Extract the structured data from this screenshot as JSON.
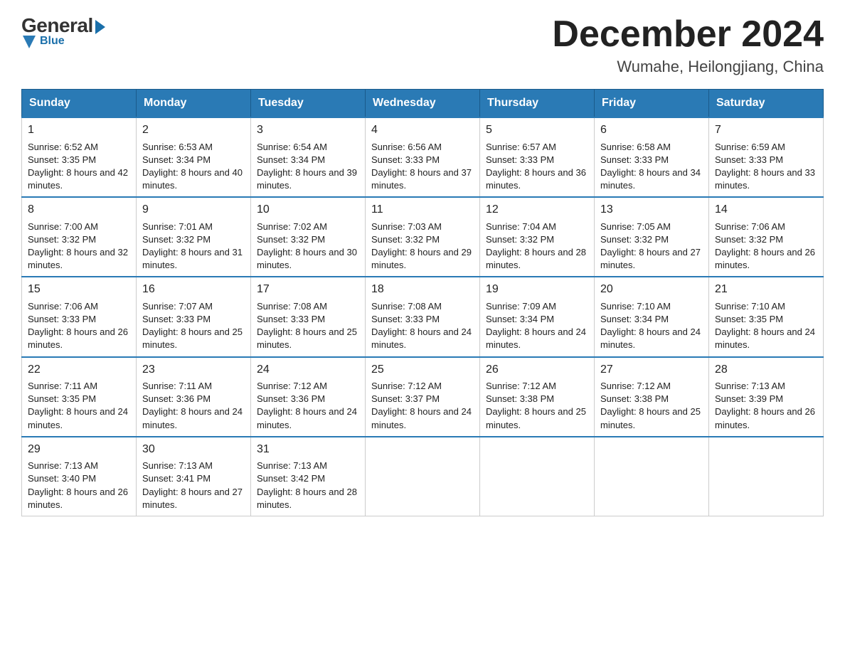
{
  "logo": {
    "general": "General",
    "blue": "Blue"
  },
  "header": {
    "month": "December 2024",
    "location": "Wumahe, Heilongjiang, China"
  },
  "days": [
    "Sunday",
    "Monday",
    "Tuesday",
    "Wednesday",
    "Thursday",
    "Friday",
    "Saturday"
  ],
  "weeks": [
    [
      {
        "day": "1",
        "sunrise": "6:52 AM",
        "sunset": "3:35 PM",
        "daylight": "8 hours and 42 minutes."
      },
      {
        "day": "2",
        "sunrise": "6:53 AM",
        "sunset": "3:34 PM",
        "daylight": "8 hours and 40 minutes."
      },
      {
        "day": "3",
        "sunrise": "6:54 AM",
        "sunset": "3:34 PM",
        "daylight": "8 hours and 39 minutes."
      },
      {
        "day": "4",
        "sunrise": "6:56 AM",
        "sunset": "3:33 PM",
        "daylight": "8 hours and 37 minutes."
      },
      {
        "day": "5",
        "sunrise": "6:57 AM",
        "sunset": "3:33 PM",
        "daylight": "8 hours and 36 minutes."
      },
      {
        "day": "6",
        "sunrise": "6:58 AM",
        "sunset": "3:33 PM",
        "daylight": "8 hours and 34 minutes."
      },
      {
        "day": "7",
        "sunrise": "6:59 AM",
        "sunset": "3:33 PM",
        "daylight": "8 hours and 33 minutes."
      }
    ],
    [
      {
        "day": "8",
        "sunrise": "7:00 AM",
        "sunset": "3:32 PM",
        "daylight": "8 hours and 32 minutes."
      },
      {
        "day": "9",
        "sunrise": "7:01 AM",
        "sunset": "3:32 PM",
        "daylight": "8 hours and 31 minutes."
      },
      {
        "day": "10",
        "sunrise": "7:02 AM",
        "sunset": "3:32 PM",
        "daylight": "8 hours and 30 minutes."
      },
      {
        "day": "11",
        "sunrise": "7:03 AM",
        "sunset": "3:32 PM",
        "daylight": "8 hours and 29 minutes."
      },
      {
        "day": "12",
        "sunrise": "7:04 AM",
        "sunset": "3:32 PM",
        "daylight": "8 hours and 28 minutes."
      },
      {
        "day": "13",
        "sunrise": "7:05 AM",
        "sunset": "3:32 PM",
        "daylight": "8 hours and 27 minutes."
      },
      {
        "day": "14",
        "sunrise": "7:06 AM",
        "sunset": "3:32 PM",
        "daylight": "8 hours and 26 minutes."
      }
    ],
    [
      {
        "day": "15",
        "sunrise": "7:06 AM",
        "sunset": "3:33 PM",
        "daylight": "8 hours and 26 minutes."
      },
      {
        "day": "16",
        "sunrise": "7:07 AM",
        "sunset": "3:33 PM",
        "daylight": "8 hours and 25 minutes."
      },
      {
        "day": "17",
        "sunrise": "7:08 AM",
        "sunset": "3:33 PM",
        "daylight": "8 hours and 25 minutes."
      },
      {
        "day": "18",
        "sunrise": "7:08 AM",
        "sunset": "3:33 PM",
        "daylight": "8 hours and 24 minutes."
      },
      {
        "day": "19",
        "sunrise": "7:09 AM",
        "sunset": "3:34 PM",
        "daylight": "8 hours and 24 minutes."
      },
      {
        "day": "20",
        "sunrise": "7:10 AM",
        "sunset": "3:34 PM",
        "daylight": "8 hours and 24 minutes."
      },
      {
        "day": "21",
        "sunrise": "7:10 AM",
        "sunset": "3:35 PM",
        "daylight": "8 hours and 24 minutes."
      }
    ],
    [
      {
        "day": "22",
        "sunrise": "7:11 AM",
        "sunset": "3:35 PM",
        "daylight": "8 hours and 24 minutes."
      },
      {
        "day": "23",
        "sunrise": "7:11 AM",
        "sunset": "3:36 PM",
        "daylight": "8 hours and 24 minutes."
      },
      {
        "day": "24",
        "sunrise": "7:12 AM",
        "sunset": "3:36 PM",
        "daylight": "8 hours and 24 minutes."
      },
      {
        "day": "25",
        "sunrise": "7:12 AM",
        "sunset": "3:37 PM",
        "daylight": "8 hours and 24 minutes."
      },
      {
        "day": "26",
        "sunrise": "7:12 AM",
        "sunset": "3:38 PM",
        "daylight": "8 hours and 25 minutes."
      },
      {
        "day": "27",
        "sunrise": "7:12 AM",
        "sunset": "3:38 PM",
        "daylight": "8 hours and 25 minutes."
      },
      {
        "day": "28",
        "sunrise": "7:13 AM",
        "sunset": "3:39 PM",
        "daylight": "8 hours and 26 minutes."
      }
    ],
    [
      {
        "day": "29",
        "sunrise": "7:13 AM",
        "sunset": "3:40 PM",
        "daylight": "8 hours and 26 minutes."
      },
      {
        "day": "30",
        "sunrise": "7:13 AM",
        "sunset": "3:41 PM",
        "daylight": "8 hours and 27 minutes."
      },
      {
        "day": "31",
        "sunrise": "7:13 AM",
        "sunset": "3:42 PM",
        "daylight": "8 hours and 28 minutes."
      },
      null,
      null,
      null,
      null
    ]
  ]
}
